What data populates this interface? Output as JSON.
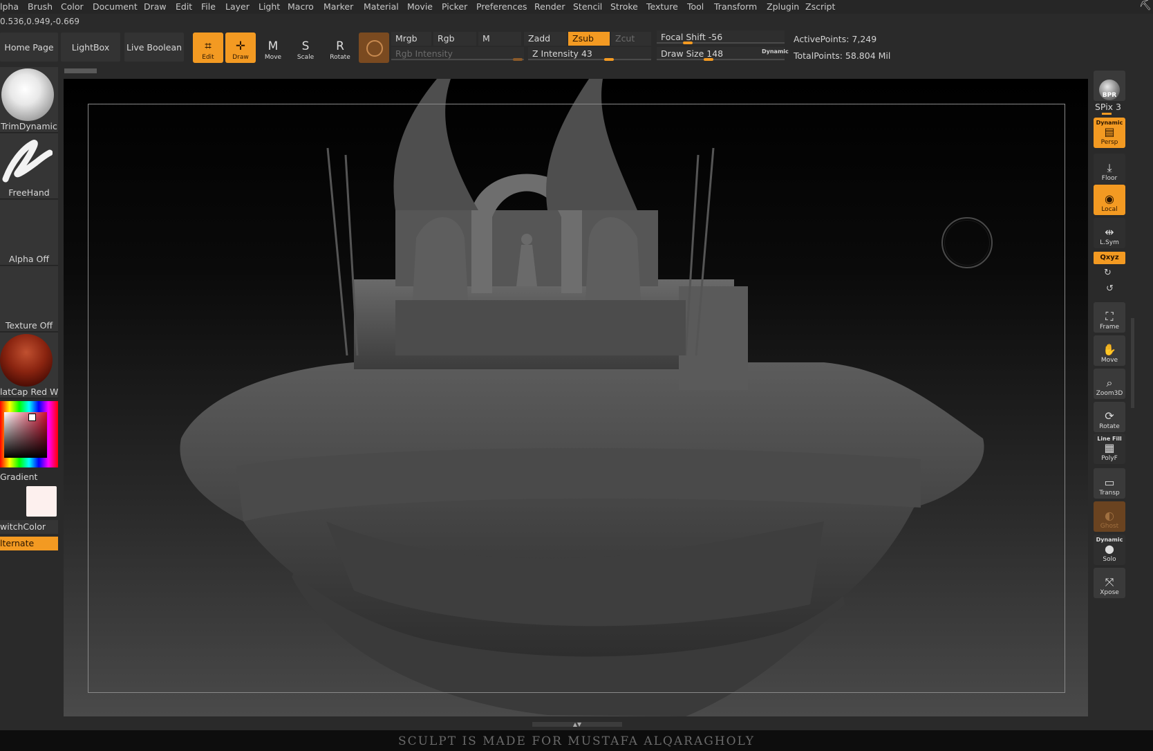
{
  "menu": [
    "lpha",
    "Brush",
    "Color",
    "Document",
    "Draw",
    "Edit",
    "File",
    "Layer",
    "Light",
    "Macro",
    "Marker",
    "Material",
    "Movie",
    "Picker",
    "Preferences",
    "Render",
    "Stencil",
    "Stroke",
    "Texture",
    "Tool",
    "Transform",
    "Zplugin",
    "Zscript"
  ],
  "coords": "0.536,0.949,-0.669",
  "nav": {
    "home": "Home Page",
    "lightbox": "LightBox",
    "live_boolean": "Live Boolean"
  },
  "modes": [
    {
      "label": "Edit",
      "glyph": "⌗",
      "active": true
    },
    {
      "label": "Draw",
      "glyph": "✛",
      "active": true
    },
    {
      "label": "Move",
      "glyph": "M",
      "active": false
    },
    {
      "label": "Scale",
      "glyph": "S",
      "active": false
    },
    {
      "label": "Rotate",
      "glyph": "R",
      "active": false
    }
  ],
  "color_mode": {
    "mrgb": "Mrgb",
    "rgb": "Rgb",
    "m": "M",
    "rgb_intensity": "Rgb Intensity"
  },
  "z_mode": {
    "zadd": "Zadd",
    "zsub": "Zsub",
    "zcut": "Zcut",
    "z_intensity_label": "Z Intensity",
    "z_intensity": "43"
  },
  "brush": {
    "focal_shift_label": "Focal Shift",
    "focal_shift": "-56",
    "draw_size_label": "Draw Size",
    "draw_size": "148",
    "dynamic": "Dynamic"
  },
  "stats": {
    "active_points": "ActivePoints: 7,249",
    "total_points": "TotalPoints: 58.804 Mil"
  },
  "left_panel": {
    "brush_name": "TrimDynamic",
    "stroke_name": "FreeHand",
    "alpha": "Alpha Off",
    "texture": "Texture Off",
    "material": "latCap Red Wax",
    "gradient": "Gradient",
    "switch_color": "witchColor",
    "alternate": "lternate"
  },
  "right_bar": {
    "bpr": "BPR",
    "spix": "SPix 3",
    "persp_dynamic": "Dynamic",
    "persp": "Persp",
    "floor": "Floor",
    "local": "Local",
    "lsym": "L.Sym",
    "xyz": "Qxyz",
    "frame": "Frame",
    "move": "Move",
    "zoom3d": "Zoom3D",
    "rotate": "Rotate",
    "linefill": "Line Fill",
    "polyf": "PolyF",
    "transp": "Transp",
    "ghost": "Ghost",
    "solo_dynamic": "Dynamic",
    "solo": "Solo",
    "xpose": "Xpose"
  },
  "footer": "SCULPT  IS MADE FOR MUSTAFA ALQARAGHOLY",
  "colors": {
    "accent": "#f39a22",
    "bg": "#2a2a2a"
  }
}
